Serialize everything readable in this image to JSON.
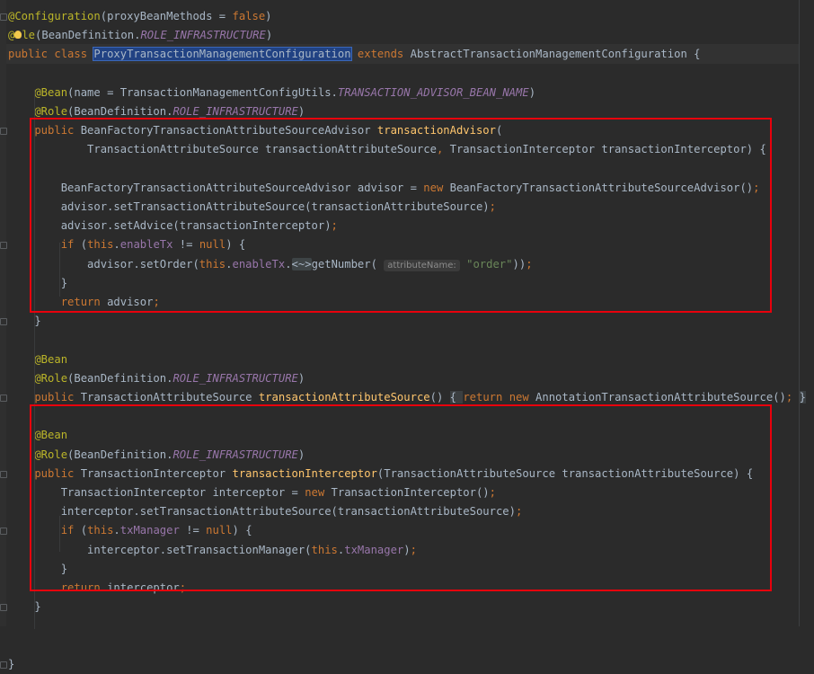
{
  "editor": {
    "lines": [
      {
        "tokens": [
          {
            "t": "@Configuration",
            "c": "ann"
          },
          {
            "t": "(proxyBeanMethods = ",
            "c": "text"
          },
          {
            "t": "false",
            "c": "kw"
          },
          {
            "t": ")",
            "c": "text"
          }
        ]
      },
      {
        "tokens": [
          {
            "t": "@",
            "c": "ann"
          },
          {
            "t": "",
            "c": "bulb"
          },
          {
            "t": "le",
            "c": "ann"
          },
          {
            "t": "(BeanDefinition.",
            "c": "text"
          },
          {
            "t": "ROLE_INFRASTRUCTURE",
            "c": "const"
          },
          {
            "t": ")",
            "c": "text"
          }
        ]
      },
      {
        "tokens": [
          {
            "t": "public class ",
            "c": "kw"
          },
          {
            "t": "ProxyTransactionManagementConfiguration",
            "c": "sel"
          },
          {
            "t": " extends ",
            "c": "kw"
          },
          {
            "t": "AbstractTransactionManagementConfiguration {",
            "c": "text"
          }
        ]
      },
      {
        "tokens": []
      },
      {
        "tokens": [
          {
            "t": "    @Bean",
            "c": "ann"
          },
          {
            "t": "(name = TransactionManagementConfigUtils.",
            "c": "text"
          },
          {
            "t": "TRANSACTION_ADVISOR_BEAN_NAME",
            "c": "const"
          },
          {
            "t": ")",
            "c": "text"
          }
        ]
      },
      {
        "tokens": [
          {
            "t": "    @Role",
            "c": "ann"
          },
          {
            "t": "(BeanDefinition.",
            "c": "text"
          },
          {
            "t": "ROLE_INFRASTRUCTURE",
            "c": "const"
          },
          {
            "t": ")",
            "c": "text"
          }
        ]
      },
      {
        "tokens": [
          {
            "t": "    public ",
            "c": "kw"
          },
          {
            "t": "BeanFactoryTransactionAttributeSourceAdvisor ",
            "c": "text"
          },
          {
            "t": "transactionAdvisor",
            "c": "fn"
          },
          {
            "t": "(",
            "c": "text"
          }
        ]
      },
      {
        "tokens": [
          {
            "t": "            TransactionAttributeSource transactionAttributeSource",
            "c": "text"
          },
          {
            "t": ", ",
            "c": "kw"
          },
          {
            "t": "TransactionInterceptor transactionInterceptor) {",
            "c": "text"
          }
        ]
      },
      {
        "tokens": []
      },
      {
        "tokens": [
          {
            "t": "        BeanFactoryTransactionAttributeSourceAdvisor advisor = ",
            "c": "text"
          },
          {
            "t": "new ",
            "c": "kw"
          },
          {
            "t": "BeanFactoryTransactionAttributeSourceAdvisor()",
            "c": "text"
          },
          {
            "t": ";",
            "c": "kw"
          }
        ]
      },
      {
        "tokens": [
          {
            "t": "        advisor.setTransactionAttributeSource(transactionAttributeSource)",
            "c": "text"
          },
          {
            "t": ";",
            "c": "kw"
          }
        ]
      },
      {
        "tokens": [
          {
            "t": "        advisor.setAdvice(transactionInterceptor)",
            "c": "text"
          },
          {
            "t": ";",
            "c": "kw"
          }
        ]
      },
      {
        "tokens": [
          {
            "t": "        if ",
            "c": "kw"
          },
          {
            "t": "(",
            "c": "text"
          },
          {
            "t": "this",
            "c": "kw"
          },
          {
            "t": ".",
            "c": "text"
          },
          {
            "t": "enableTx",
            "c": "field"
          },
          {
            "t": " != ",
            "c": "text"
          },
          {
            "t": "null",
            "c": "kw"
          },
          {
            "t": ") {",
            "c": "text"
          }
        ]
      },
      {
        "tokens": [
          {
            "t": "            advisor.setOrder(",
            "c": "text"
          },
          {
            "t": "this",
            "c": "kw"
          },
          {
            "t": ".",
            "c": "text"
          },
          {
            "t": "enableTx",
            "c": "field"
          },
          {
            "t": ".",
            "c": "text"
          },
          {
            "t": "<~>",
            "c": "badge"
          },
          {
            "t": "getNumber( ",
            "c": "text"
          },
          {
            "t": "attributeName:",
            "c": "hint"
          },
          {
            "t": " ",
            "c": "text"
          },
          {
            "t": "\"order\"",
            "c": "str"
          },
          {
            "t": "))",
            "c": "text"
          },
          {
            "t": ";",
            "c": "kw"
          }
        ]
      },
      {
        "tokens": [
          {
            "t": "        }",
            "c": "text"
          }
        ]
      },
      {
        "tokens": [
          {
            "t": "        return ",
            "c": "kw"
          },
          {
            "t": "advisor",
            "c": "text"
          },
          {
            "t": ";",
            "c": "kw"
          }
        ]
      },
      {
        "tokens": [
          {
            "t": "    }",
            "c": "text"
          }
        ]
      },
      {
        "tokens": []
      },
      {
        "tokens": [
          {
            "t": "    @Bean",
            "c": "ann"
          }
        ]
      },
      {
        "tokens": [
          {
            "t": "    @Role",
            "c": "ann"
          },
          {
            "t": "(BeanDefinition.",
            "c": "text"
          },
          {
            "t": "ROLE_INFRASTRUCTURE",
            "c": "const"
          },
          {
            "t": ")",
            "c": "text"
          }
        ]
      },
      {
        "tokens": [
          {
            "t": "    public ",
            "c": "kw"
          },
          {
            "t": "TransactionAttributeSource ",
            "c": "text"
          },
          {
            "t": "transactionAttributeSource",
            "c": "fn"
          },
          {
            "t": "() ",
            "c": "text"
          },
          {
            "t": "{ ",
            "c": "fold"
          },
          {
            "t": "return new ",
            "c": "kw"
          },
          {
            "t": "AnnotationTransactionAttributeSource()",
            "c": "text"
          },
          {
            "t": "; ",
            "c": "kw"
          },
          {
            "t": "}",
            "c": "fold"
          }
        ]
      },
      {
        "tokens": []
      },
      {
        "tokens": [
          {
            "t": "    @Bean",
            "c": "ann"
          }
        ]
      },
      {
        "tokens": [
          {
            "t": "    @Role",
            "c": "ann"
          },
          {
            "t": "(BeanDefinition.",
            "c": "text"
          },
          {
            "t": "ROLE_INFRASTRUCTURE",
            "c": "const"
          },
          {
            "t": ")",
            "c": "text"
          }
        ]
      },
      {
        "tokens": [
          {
            "t": "    public ",
            "c": "kw"
          },
          {
            "t": "TransactionInterceptor ",
            "c": "text"
          },
          {
            "t": "transactionInterceptor",
            "c": "fn"
          },
          {
            "t": "(TransactionAttributeSource transactionAttributeSource) {",
            "c": "text"
          }
        ]
      },
      {
        "tokens": [
          {
            "t": "        TransactionInterceptor interceptor = ",
            "c": "text"
          },
          {
            "t": "new ",
            "c": "kw"
          },
          {
            "t": "TransactionInterceptor()",
            "c": "text"
          },
          {
            "t": ";",
            "c": "kw"
          }
        ]
      },
      {
        "tokens": [
          {
            "t": "        interceptor.setTransactionAttributeSource(transactionAttributeSource)",
            "c": "text"
          },
          {
            "t": ";",
            "c": "kw"
          }
        ]
      },
      {
        "tokens": [
          {
            "t": "        if ",
            "c": "kw"
          },
          {
            "t": "(",
            "c": "text"
          },
          {
            "t": "this",
            "c": "kw"
          },
          {
            "t": ".",
            "c": "text"
          },
          {
            "t": "txManager",
            "c": "field"
          },
          {
            "t": " != ",
            "c": "text"
          },
          {
            "t": "null",
            "c": "kw"
          },
          {
            "t": ") {",
            "c": "text"
          }
        ]
      },
      {
        "tokens": [
          {
            "t": "            interceptor.setTransactionManager(",
            "c": "text"
          },
          {
            "t": "this",
            "c": "kw"
          },
          {
            "t": ".",
            "c": "text"
          },
          {
            "t": "txManager",
            "c": "field"
          },
          {
            "t": ")",
            "c": "text"
          },
          {
            "t": ";",
            "c": "kw"
          }
        ]
      },
      {
        "tokens": [
          {
            "t": "        }",
            "c": "text"
          }
        ]
      },
      {
        "tokens": [
          {
            "t": "        return ",
            "c": "kw"
          },
          {
            "t": "interceptor",
            "c": "text"
          },
          {
            "t": ";",
            "c": "kw"
          }
        ]
      },
      {
        "tokens": [
          {
            "t": "    }",
            "c": "text"
          }
        ]
      },
      {
        "tokens": []
      },
      {
        "tokens": []
      },
      {
        "tokens": [
          {
            "t": "}",
            "c": "text"
          }
        ]
      }
    ]
  },
  "colors": {
    "background": "#2b2b2b",
    "annotation": "#bbb529",
    "keyword": "#cc7832",
    "constant": "#9876aa",
    "function": "#ffc66d",
    "string": "#6a8759",
    "text": "#a9b7c6",
    "highlight_box": "#e8000c"
  }
}
